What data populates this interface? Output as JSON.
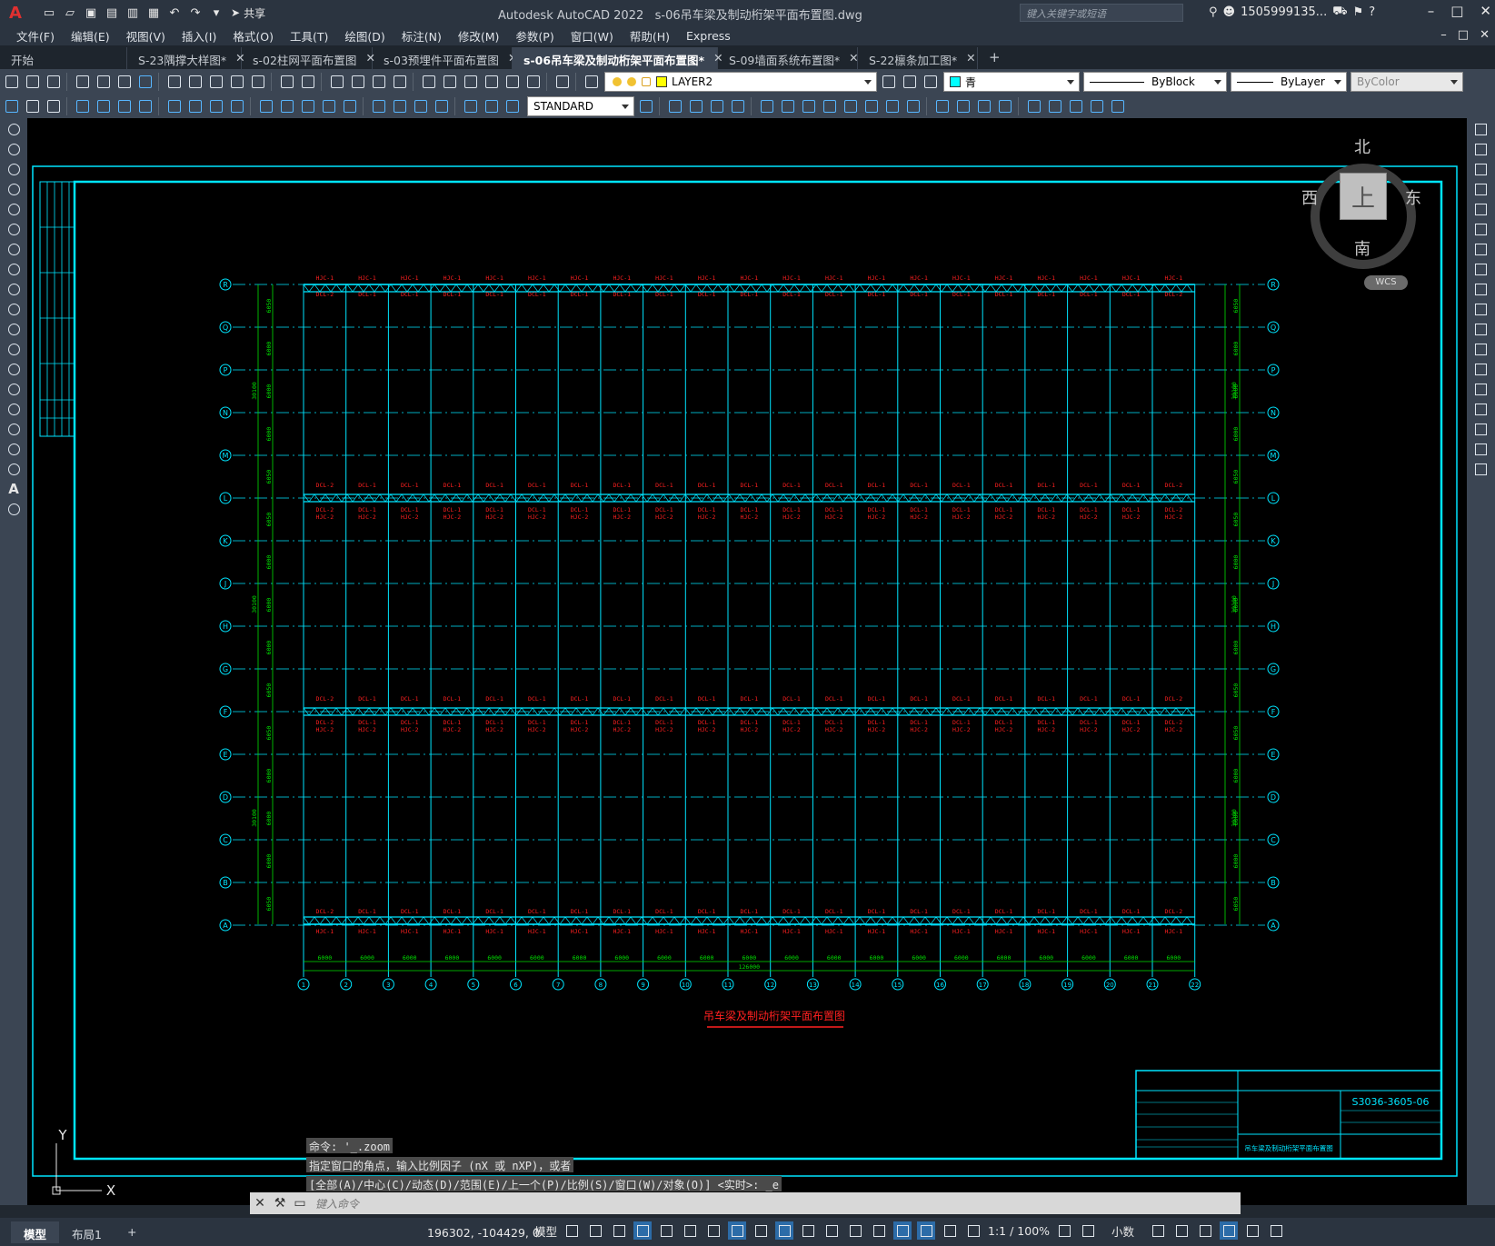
{
  "app": {
    "title": "Autodesk AutoCAD 2022",
    "file": "s-06吊车梁及制动桁架平面布置图.dwg",
    "logo": "A",
    "share": "共享",
    "search_placeholder": "键入关键字或短语",
    "user": "1505999135...",
    "window_controls": [
      "–",
      "□",
      "✕"
    ]
  },
  "menu": [
    "文件(F)",
    "编辑(E)",
    "视图(V)",
    "插入(I)",
    "格式(O)",
    "工具(T)",
    "绘图(D)",
    "标注(N)",
    "修改(M)",
    "参数(P)",
    "窗口(W)",
    "帮助(H)",
    "Express"
  ],
  "tabs": [
    {
      "label": "开始",
      "closable": false,
      "active": false
    },
    {
      "label": "S-23隅撑大样图*",
      "closable": true,
      "active": false
    },
    {
      "label": "s-02柱网平面布置图",
      "closable": true,
      "active": false
    },
    {
      "label": "s-03预埋件平面布置图",
      "closable": true,
      "active": false
    },
    {
      "label": "s-06吊车梁及制动桁架平面布置图*",
      "closable": true,
      "active": true
    },
    {
      "label": "S-09墙面系统布置图*",
      "closable": true,
      "active": false
    },
    {
      "label": "S-22檩条加工图*",
      "closable": true,
      "active": false
    }
  ],
  "tab_close": "✕",
  "tab_add": "+",
  "toolbar": {
    "layer": "LAYER2",
    "color": "青",
    "linetype": "ByBlock",
    "lineweight": "ByLayer",
    "plotstyle": "ByColor",
    "textstyle": "STANDARD",
    "accent_cyan": "#00ffff",
    "accent_layer": "#ffff00"
  },
  "viewcube": {
    "top": "上",
    "north": "北",
    "south": "南",
    "west": "西",
    "east": "东",
    "wcs": "WCS"
  },
  "drawing": {
    "title": "吊车梁及制动桁架平面布置图",
    "sheet_no": "S3036-3605-06",
    "sheet_title": "吊车梁及制动桁架平面布置图",
    "row_axes": [
      "R",
      "Q",
      "P",
      "N",
      "M",
      "L",
      "K",
      "J",
      "H",
      "G",
      "F",
      "E",
      "D",
      "C",
      "B",
      "A"
    ],
    "col_axes": [
      "1",
      "2",
      "3",
      "4",
      "5",
      "6",
      "7",
      "8",
      "9",
      "10",
      "11",
      "12",
      "13",
      "14",
      "15",
      "16",
      "17",
      "18",
      "19",
      "20",
      "21",
      "22"
    ],
    "bay_dim": "6000",
    "total_dim": "126000",
    "row_dims": [
      "6050",
      "6000",
      "6000",
      "6000",
      "6050"
    ],
    "side_total": "30100",
    "beam_labels": {
      "top": "HJC-1",
      "beam": "DCL-1",
      "beam_end": "DCL-2",
      "pair_top": "DCL-2",
      "pair_bot": "HJC-2"
    },
    "colors": {
      "frame": "#00e5ff",
      "beam": "#ff2020",
      "dim": "#00e000",
      "truss": "#00e5ff",
      "axis": "#00e5ff"
    }
  },
  "command": {
    "history": [
      "命令: '_.zoom",
      "指定窗口的角点，输入比例因子 (nX 或 nXP)，或者",
      "[全部(A)/中心(C)/动态(D)/范围(E)/上一个(P)/比例(S)/窗口(W)/对象(O)] <实时>: _e"
    ],
    "placeholder": "键入命令"
  },
  "status": {
    "layout_tabs": [
      "模型",
      "布局1"
    ],
    "add": "+",
    "coords": "196302, -104429, 0",
    "model": "模型",
    "scale": "1:1 / 100%",
    "units": "小数"
  }
}
